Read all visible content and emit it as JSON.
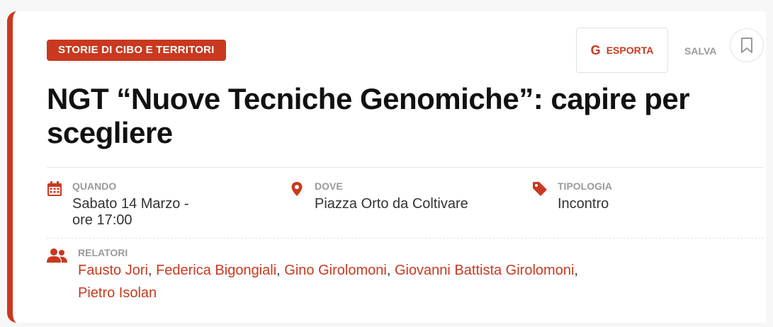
{
  "event": {
    "category": "STORIE DI CIBO E TERRITORI",
    "title": "NGT “Nuove Tecniche Genomiche”: capire per scegliere"
  },
  "actions": {
    "export_icon": "G",
    "export_label": "ESPORTA",
    "save_label": "SALVA",
    "bookmark_icon": "bookmark-icon"
  },
  "details": {
    "when": {
      "label": "QUANDO",
      "value_line1": "Sabato 14 Marzo -",
      "value_line2": "ore 17:00",
      "icon": "calendar-icon"
    },
    "where": {
      "label": "DOVE",
      "value": "Piazza Orto da Coltivare",
      "icon": "map-pin-icon"
    },
    "type": {
      "label": "TIPOLOGIA",
      "value": "Incontro",
      "icon": "tag-icon"
    }
  },
  "speakers": {
    "label": "RELATORI",
    "icon": "users-icon",
    "names": [
      "Fausto Jori",
      "Federica Bigongiali",
      "Gino Girolomoni",
      "Giovanni Battista Girolomoni",
      "Pietro Isolan"
    ]
  },
  "colors": {
    "accent": "#c9391f",
    "muted": "#9a9a9a",
    "text": "#111111"
  }
}
